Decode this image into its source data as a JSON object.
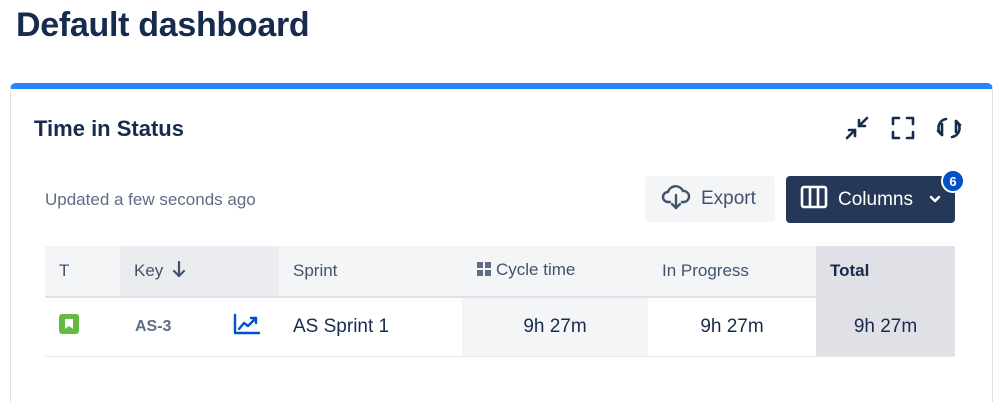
{
  "page": {
    "title": "Default dashboard"
  },
  "gadget": {
    "title": "Time in Status",
    "updated_text": "Updated a few seconds ago",
    "actions": [
      "collapse-icon",
      "fullscreen-icon",
      "refresh-icon"
    ],
    "export_label": "Export",
    "columns_label": "Columns",
    "columns_badge": "6",
    "accent_color": "#2684ff"
  },
  "table": {
    "headers": {
      "type": "T",
      "key": "Key",
      "sprint": "Sprint",
      "cycle_time": "Cycle time",
      "in_progress": "In Progress",
      "total": "Total"
    },
    "rows": [
      {
        "type_icon": "story-icon",
        "key": "AS-3",
        "chart_icon": "trend-chart-icon",
        "sprint": "AS Sprint 1",
        "cycle_time": "9h 27m",
        "in_progress": "9h 27m",
        "total": "9h 27m"
      }
    ]
  }
}
